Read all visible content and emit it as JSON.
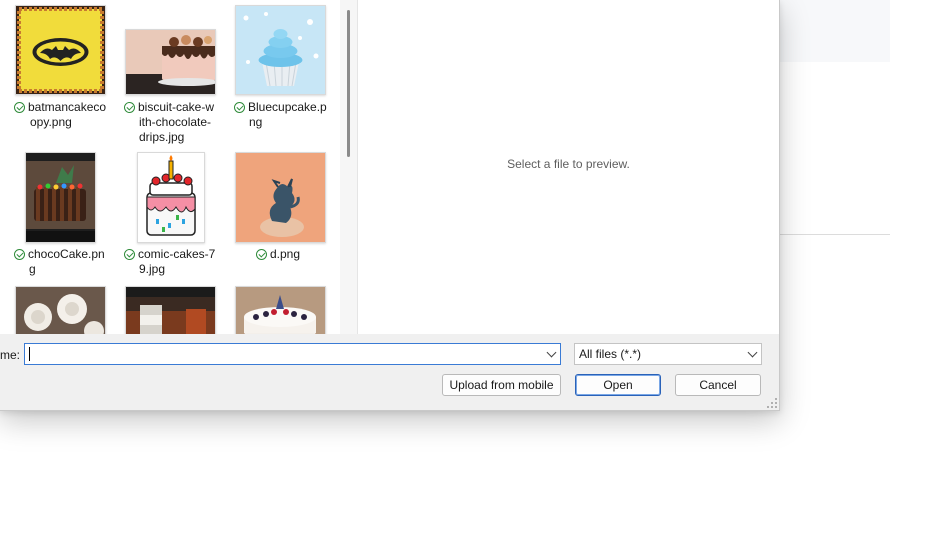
{
  "preview": {
    "placeholder": "Select a file to preview."
  },
  "files": [
    {
      "name_lines": [
        "batmancakeco",
        "opy.png"
      ],
      "thumbnail": "batman-cake-thumbnail",
      "status": "synced"
    },
    {
      "name_lines": [
        "biscuit-cake-w",
        "ith-chocolate-",
        "drips.jpg"
      ],
      "thumbnail": "chocolate-drip-cake-thumbnail",
      "status": "synced"
    },
    {
      "name_lines": [
        "Bluecupcake.p",
        "ng"
      ],
      "thumbnail": "blue-cupcake-thumbnail",
      "status": "synced"
    },
    {
      "name_lines": [
        "chocoCake.pn",
        "g"
      ],
      "thumbnail": "chocolate-cake-thumbnail",
      "status": "synced"
    },
    {
      "name_lines": [
        "comic-cakes-7",
        "9.jpg"
      ],
      "thumbnail": "comic-cake-thumbnail",
      "status": "synced"
    },
    {
      "name_lines": [
        "d.png"
      ],
      "thumbnail": "dragon-figure-thumbnail",
      "status": "synced"
    },
    {
      "name_lines": [
        ""
      ],
      "thumbnail": "white-roses-cake-thumbnail",
      "status": ""
    },
    {
      "name_lines": [
        ""
      ],
      "thumbnail": "bottle-photo-thumbnail",
      "status": ""
    },
    {
      "name_lines": [
        ""
      ],
      "thumbnail": "berry-cake-thumbnail",
      "status": ""
    }
  ],
  "bottom_bar": {
    "file_name_label": "me:",
    "file_name_value": "",
    "file_type_filter": "All files (*.*)",
    "upload_label": "Upload from mobile",
    "open_label": "Open",
    "cancel_label": "Cancel"
  },
  "colors": {
    "accent": "#2a62b8",
    "check": "#2f8b3a"
  }
}
